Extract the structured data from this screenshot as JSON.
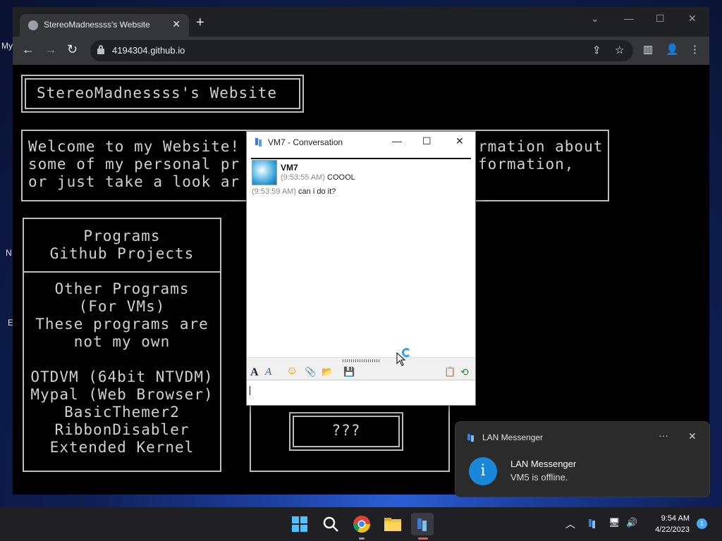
{
  "desktop": {
    "icon_labels": [
      "My",
      "N",
      "E"
    ]
  },
  "browser": {
    "tab_title": "StereoMadnessss's Website",
    "tab_close": "✕",
    "new_tab": "+",
    "url": "4194304.github.io",
    "window_controls": {
      "dropdown": "⌄",
      "minimize": "—",
      "maximize": "☐",
      "close": "✕"
    },
    "nav": {
      "back": "←",
      "forward": "→",
      "reload": "↻"
    },
    "toolbar_icons": {
      "share": "⇪",
      "bookmark": "☆",
      "sidebar": "▥",
      "profile": "👤",
      "menu": "⋮"
    }
  },
  "webpage": {
    "title": "StereoMadnessss's Website",
    "welcome_lines": [
      "Welcome to my Website!",
      "some of my personal pr",
      "or just take a look ar"
    ],
    "welcome_tail_lines": [
      "rmation about",
      "formation,"
    ],
    "nav_links": [
      "Programs",
      "Github Projects"
    ],
    "other_programs_header": [
      "Other Programs",
      "(For VMs)",
      "These programs are",
      "not my own"
    ],
    "program_list": [
      "OTDVM (64bit NTVDM)",
      "Mypal (Web Browser)",
      "BasicThemer2",
      "RibbonDisabler",
      "Extended Kernel"
    ],
    "mystery_button": "???"
  },
  "conversation": {
    "window_title": "VM7 - Conversation",
    "controls": {
      "minimize": "—",
      "maximize": "☐",
      "close": "✕"
    },
    "sender": "VM7",
    "messages": [
      {
        "time": "(9:53:55 AM)",
        "text": "COOOL"
      },
      {
        "time": "(9:53:59 AM)",
        "text": "can i do it?"
      }
    ],
    "format_icons": {
      "font": "A",
      "font_style": "A",
      "emoticon": "☺",
      "attach_file": "📎",
      "attach_folder": "📂",
      "save": "💾",
      "copy": "📋",
      "history": "⟲"
    },
    "input_value": ""
  },
  "notification": {
    "app_name": "LAN Messenger",
    "more": "···",
    "close": "✕",
    "icon": "i",
    "title": "LAN Messenger",
    "body": "VM5 is offline."
  },
  "taskbar": {
    "time": "9:54 AM",
    "date": "4/22/2023",
    "notification_count": "1",
    "tray_icons": {
      "chevron": "︿",
      "volume": "🔊",
      "network": "🖥"
    }
  }
}
